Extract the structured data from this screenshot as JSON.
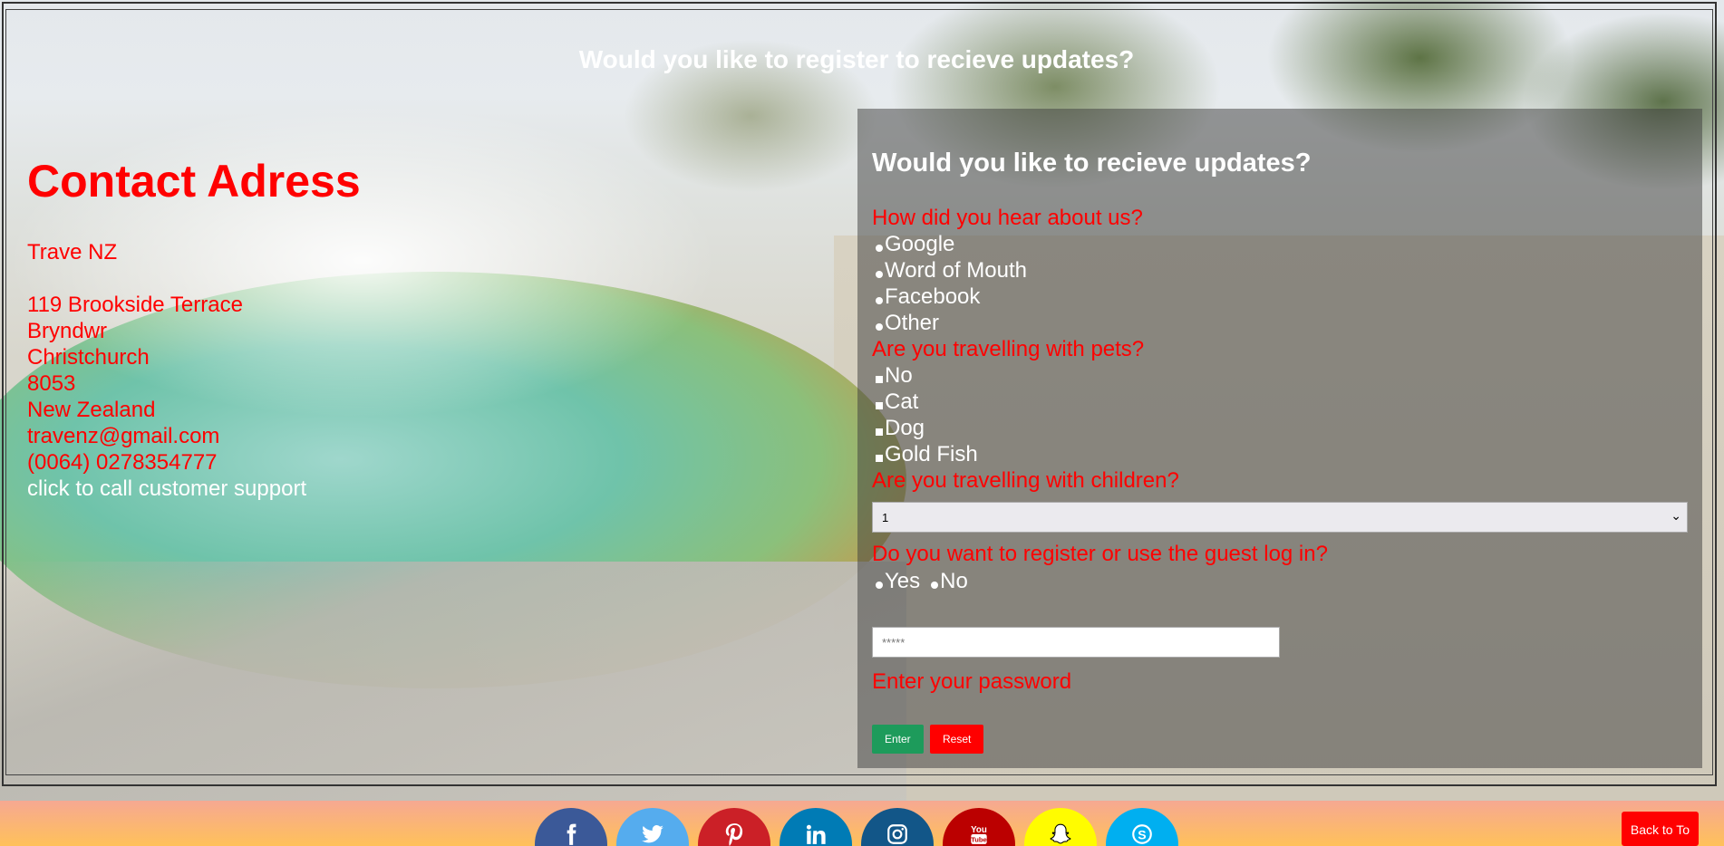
{
  "banner": {
    "title": "Would you like to register to recieve updates?"
  },
  "contact": {
    "heading": "Contact Adress",
    "company": "Trave NZ",
    "street": "119 Brookside Terrace",
    "suburb": "Bryndwr",
    "city": "Christchurch",
    "postcode": "8053",
    "country": "New Zealand",
    "email": "travenz@gmail.com",
    "phone": "(0064) 0278354777",
    "call_link": "click to call customer support"
  },
  "form": {
    "heading": "Would you like to recieve updates?",
    "q_hear": "How did you hear about us?",
    "hear_options": [
      "Google",
      "Word of Mouth",
      "Facebook",
      "Other"
    ],
    "q_pets": "Are you travelling with pets?",
    "pet_options": [
      "No",
      "Cat",
      "Dog",
      "Gold Fish"
    ],
    "q_children": "Are you travelling with children?",
    "children_selected": "1",
    "q_register": "Do you want to register or use the guest log in?",
    "register_options": [
      "Yes",
      "No"
    ],
    "password_value": "*****",
    "password_label": "Enter your password",
    "enter_label": "Enter",
    "reset_label": "Reset"
  },
  "footer": {
    "social": [
      {
        "name": "facebook-icon",
        "color": "#3b5998"
      },
      {
        "name": "twitter-icon",
        "color": "#55acee"
      },
      {
        "name": "pinterest-icon",
        "color": "#cb2027"
      },
      {
        "name": "linkedin-icon",
        "color": "#007bb5"
      },
      {
        "name": "instagram-icon",
        "color": "#125688"
      },
      {
        "name": "youtube-icon",
        "color": "#bb0000"
      },
      {
        "name": "snapchat-icon",
        "color": "#fffc00"
      },
      {
        "name": "skype-icon",
        "color": "#00aff0"
      }
    ],
    "back_to_top": "Back to To"
  }
}
